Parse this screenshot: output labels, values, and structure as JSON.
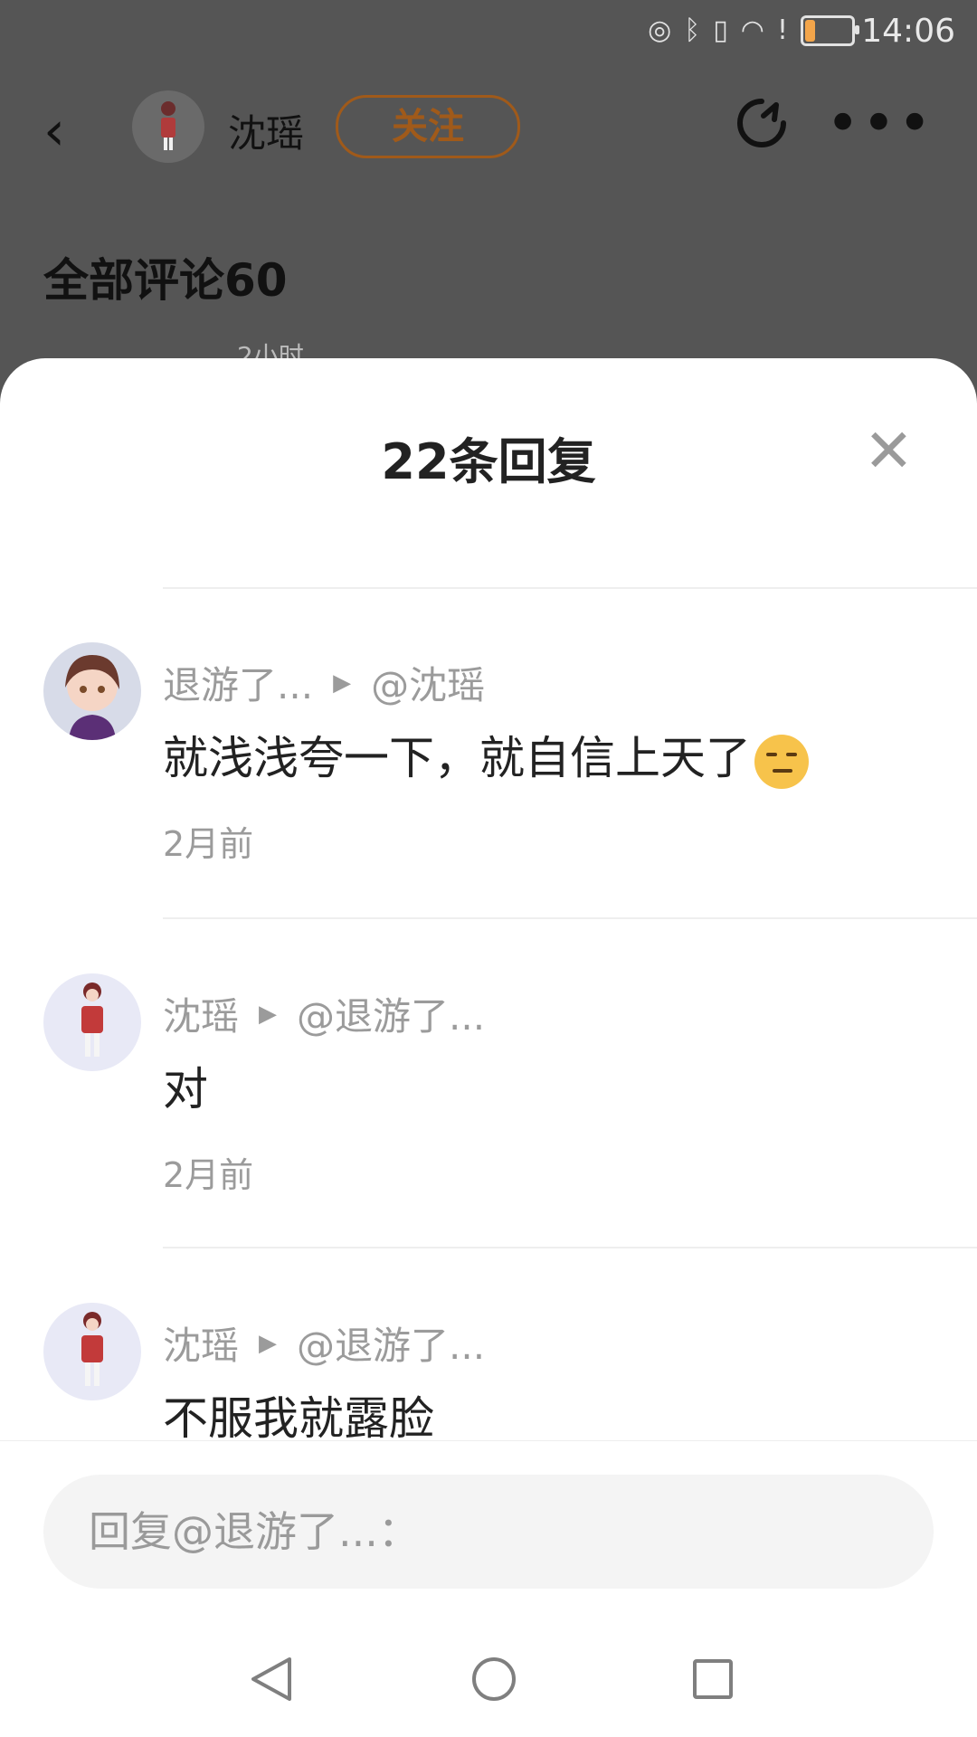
{
  "status_bar": {
    "time": "14:06",
    "battery_level_fraction": 0.2
  },
  "header": {
    "author_name": "沈瑶",
    "follow_label": "关注"
  },
  "background": {
    "section_title": "全部评论60",
    "snippet": "2小时"
  },
  "sheet": {
    "title": "22条回复"
  },
  "replies": [
    {
      "user": "退游了...",
      "target": "@沈瑶",
      "content": "就浅浅夸一下，就自信上天了",
      "emoji": "unamused-face",
      "time": "2月前",
      "avatar": "anime-girl-brown-hair"
    },
    {
      "user": "沈瑶",
      "target": "@退游了...",
      "content": "对",
      "time": "2月前",
      "avatar": "red-dress-character"
    },
    {
      "user": "沈瑶",
      "target": "@退游了...",
      "content": "不服我就露脸",
      "time": "",
      "avatar": "red-dress-character"
    }
  ],
  "input": {
    "placeholder": "回复@退游了...："
  },
  "icons": {
    "back": "chevron-left-icon",
    "share": "share-icon",
    "more": "more-icon",
    "close": "close-icon"
  },
  "colors": {
    "follow": "#a05a1a",
    "battery": "#f3a54a",
    "sheet_bg": "#ffffff",
    "overlay_bg": "#555555"
  }
}
